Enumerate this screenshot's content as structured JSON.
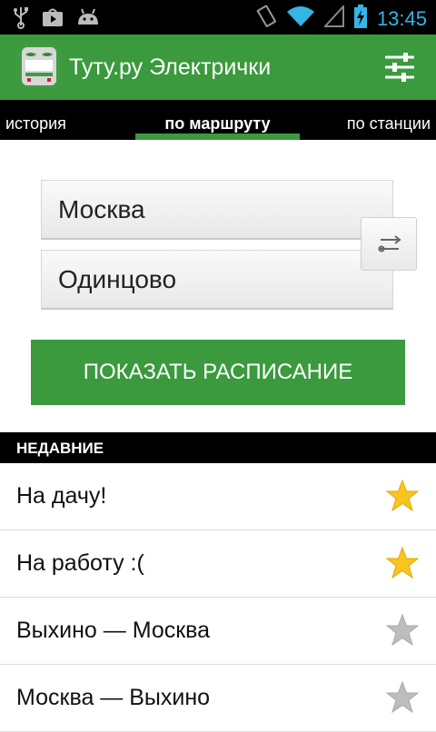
{
  "status_bar": {
    "time": "13:45",
    "icons": [
      "usb-icon",
      "play-store-icon",
      "android-icon",
      "vibrate-icon",
      "wifi-icon",
      "signal-icon",
      "battery-charging-icon"
    ]
  },
  "app_bar": {
    "title": "Туту.ру Электрички",
    "app_icon": "train-icon",
    "settings_icon": "sliders-icon"
  },
  "tabs": [
    {
      "label": "история",
      "selected": false
    },
    {
      "label": "по маршруту",
      "selected": true
    },
    {
      "label": "по станции",
      "selected": false
    }
  ],
  "route_form": {
    "from": "Москва",
    "to": "Одинцово",
    "swap_icon": "swap-icon",
    "submit_label": "ПОКАЗАТЬ РАСПИСАНИЕ"
  },
  "recent": {
    "header": "НЕДАВНИЕ",
    "items": [
      {
        "label": "На дачу!",
        "favorite": true
      },
      {
        "label": "На работу :(",
        "favorite": true
      },
      {
        "label": "Выхино — Москва",
        "favorite": false
      },
      {
        "label": "Москва — Выхино",
        "favorite": false
      }
    ]
  },
  "colors": {
    "brand_green": "#3a9a3d",
    "star_active": "#f7c51d",
    "star_inactive": "#bdbdbd",
    "clock_blue": "#33b5e5"
  }
}
